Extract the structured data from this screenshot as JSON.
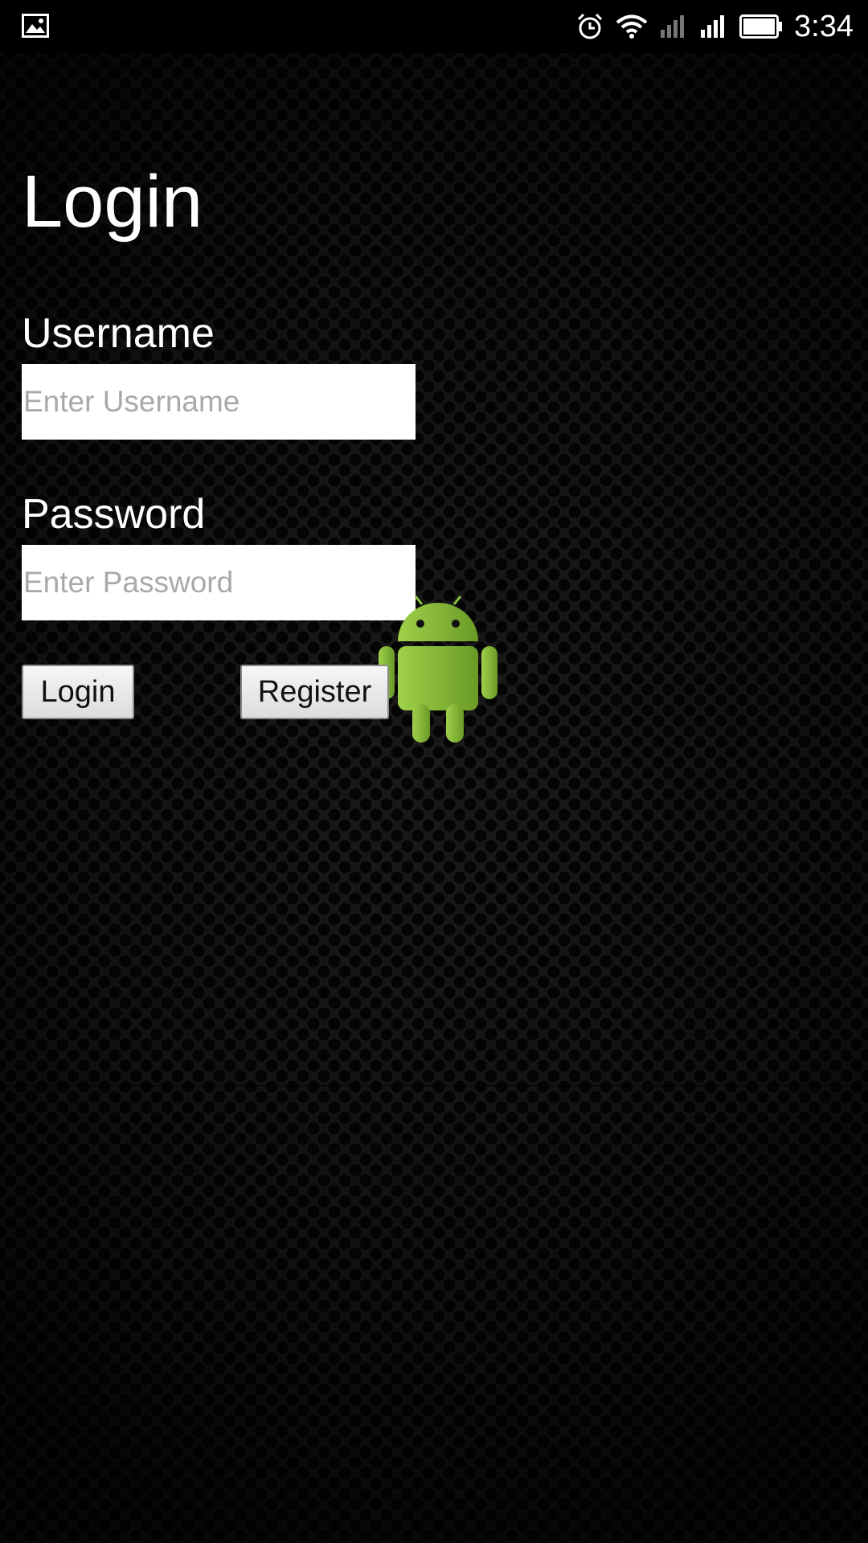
{
  "status_bar": {
    "time": "3:34",
    "icons": [
      "image-notification-icon",
      "alarm-icon",
      "wifi-icon",
      "signal-sim1-icon",
      "signal-sim2-icon",
      "battery-icon"
    ]
  },
  "login_form": {
    "title": "Login",
    "username_label": "Username",
    "username_placeholder": "Enter Username",
    "username_value": "",
    "password_label": "Password",
    "password_placeholder": "Enter Password",
    "password_value": "",
    "login_button": "Login",
    "register_button": "Register"
  },
  "colors": {
    "background": "#161616",
    "text": "#ffffff",
    "field_background": "#ffffff",
    "placeholder": "#a9a9a9",
    "android_green": "#8cc63f"
  }
}
